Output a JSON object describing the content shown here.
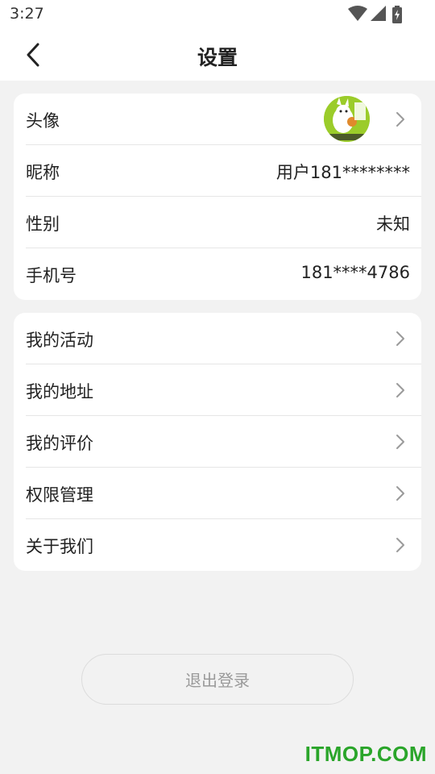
{
  "status": {
    "time": "3:27"
  },
  "header": {
    "title": "设置"
  },
  "profile": {
    "avatar_label": "头像",
    "nickname_label": "昵称",
    "nickname_value": "用户181********",
    "gender_label": "性别",
    "gender_value": "未知",
    "phone_label": "手机号",
    "phone_value": "181****4786"
  },
  "menu": {
    "items": [
      {
        "label": "我的活动"
      },
      {
        "label": "我的地址"
      },
      {
        "label": "我的评价"
      },
      {
        "label": "权限管理"
      },
      {
        "label": "关于我们"
      }
    ]
  },
  "logout": {
    "label": "退出登录"
  },
  "watermark": {
    "text": "ITMOP.COM"
  },
  "colors": {
    "background": "#f2f2f2",
    "watermark": "#2aa52a",
    "avatar_bg": "#9bcc2a"
  }
}
